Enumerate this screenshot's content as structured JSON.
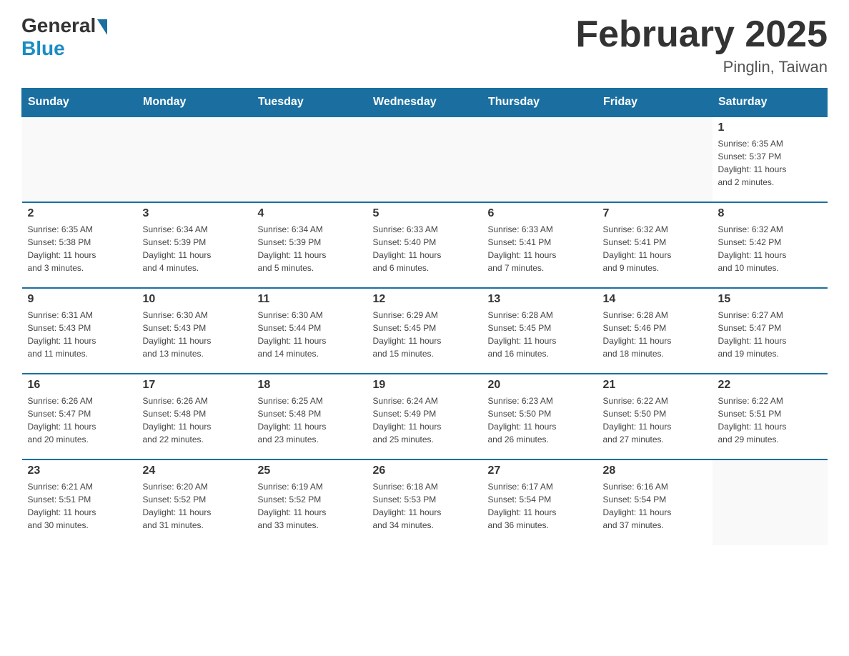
{
  "logo": {
    "general": "General",
    "blue": "Blue"
  },
  "title": "February 2025",
  "location": "Pinglin, Taiwan",
  "days_of_week": [
    "Sunday",
    "Monday",
    "Tuesday",
    "Wednesday",
    "Thursday",
    "Friday",
    "Saturday"
  ],
  "weeks": [
    [
      {
        "day": "",
        "info": ""
      },
      {
        "day": "",
        "info": ""
      },
      {
        "day": "",
        "info": ""
      },
      {
        "day": "",
        "info": ""
      },
      {
        "day": "",
        "info": ""
      },
      {
        "day": "",
        "info": ""
      },
      {
        "day": "1",
        "info": "Sunrise: 6:35 AM\nSunset: 5:37 PM\nDaylight: 11 hours\nand 2 minutes."
      }
    ],
    [
      {
        "day": "2",
        "info": "Sunrise: 6:35 AM\nSunset: 5:38 PM\nDaylight: 11 hours\nand 3 minutes."
      },
      {
        "day": "3",
        "info": "Sunrise: 6:34 AM\nSunset: 5:39 PM\nDaylight: 11 hours\nand 4 minutes."
      },
      {
        "day": "4",
        "info": "Sunrise: 6:34 AM\nSunset: 5:39 PM\nDaylight: 11 hours\nand 5 minutes."
      },
      {
        "day": "5",
        "info": "Sunrise: 6:33 AM\nSunset: 5:40 PM\nDaylight: 11 hours\nand 6 minutes."
      },
      {
        "day": "6",
        "info": "Sunrise: 6:33 AM\nSunset: 5:41 PM\nDaylight: 11 hours\nand 7 minutes."
      },
      {
        "day": "7",
        "info": "Sunrise: 6:32 AM\nSunset: 5:41 PM\nDaylight: 11 hours\nand 9 minutes."
      },
      {
        "day": "8",
        "info": "Sunrise: 6:32 AM\nSunset: 5:42 PM\nDaylight: 11 hours\nand 10 minutes."
      }
    ],
    [
      {
        "day": "9",
        "info": "Sunrise: 6:31 AM\nSunset: 5:43 PM\nDaylight: 11 hours\nand 11 minutes."
      },
      {
        "day": "10",
        "info": "Sunrise: 6:30 AM\nSunset: 5:43 PM\nDaylight: 11 hours\nand 13 minutes."
      },
      {
        "day": "11",
        "info": "Sunrise: 6:30 AM\nSunset: 5:44 PM\nDaylight: 11 hours\nand 14 minutes."
      },
      {
        "day": "12",
        "info": "Sunrise: 6:29 AM\nSunset: 5:45 PM\nDaylight: 11 hours\nand 15 minutes."
      },
      {
        "day": "13",
        "info": "Sunrise: 6:28 AM\nSunset: 5:45 PM\nDaylight: 11 hours\nand 16 minutes."
      },
      {
        "day": "14",
        "info": "Sunrise: 6:28 AM\nSunset: 5:46 PM\nDaylight: 11 hours\nand 18 minutes."
      },
      {
        "day": "15",
        "info": "Sunrise: 6:27 AM\nSunset: 5:47 PM\nDaylight: 11 hours\nand 19 minutes."
      }
    ],
    [
      {
        "day": "16",
        "info": "Sunrise: 6:26 AM\nSunset: 5:47 PM\nDaylight: 11 hours\nand 20 minutes."
      },
      {
        "day": "17",
        "info": "Sunrise: 6:26 AM\nSunset: 5:48 PM\nDaylight: 11 hours\nand 22 minutes."
      },
      {
        "day": "18",
        "info": "Sunrise: 6:25 AM\nSunset: 5:48 PM\nDaylight: 11 hours\nand 23 minutes."
      },
      {
        "day": "19",
        "info": "Sunrise: 6:24 AM\nSunset: 5:49 PM\nDaylight: 11 hours\nand 25 minutes."
      },
      {
        "day": "20",
        "info": "Sunrise: 6:23 AM\nSunset: 5:50 PM\nDaylight: 11 hours\nand 26 minutes."
      },
      {
        "day": "21",
        "info": "Sunrise: 6:22 AM\nSunset: 5:50 PM\nDaylight: 11 hours\nand 27 minutes."
      },
      {
        "day": "22",
        "info": "Sunrise: 6:22 AM\nSunset: 5:51 PM\nDaylight: 11 hours\nand 29 minutes."
      }
    ],
    [
      {
        "day": "23",
        "info": "Sunrise: 6:21 AM\nSunset: 5:51 PM\nDaylight: 11 hours\nand 30 minutes."
      },
      {
        "day": "24",
        "info": "Sunrise: 6:20 AM\nSunset: 5:52 PM\nDaylight: 11 hours\nand 31 minutes."
      },
      {
        "day": "25",
        "info": "Sunrise: 6:19 AM\nSunset: 5:52 PM\nDaylight: 11 hours\nand 33 minutes."
      },
      {
        "day": "26",
        "info": "Sunrise: 6:18 AM\nSunset: 5:53 PM\nDaylight: 11 hours\nand 34 minutes."
      },
      {
        "day": "27",
        "info": "Sunrise: 6:17 AM\nSunset: 5:54 PM\nDaylight: 11 hours\nand 36 minutes."
      },
      {
        "day": "28",
        "info": "Sunrise: 6:16 AM\nSunset: 5:54 PM\nDaylight: 11 hours\nand 37 minutes."
      },
      {
        "day": "",
        "info": ""
      }
    ]
  ]
}
